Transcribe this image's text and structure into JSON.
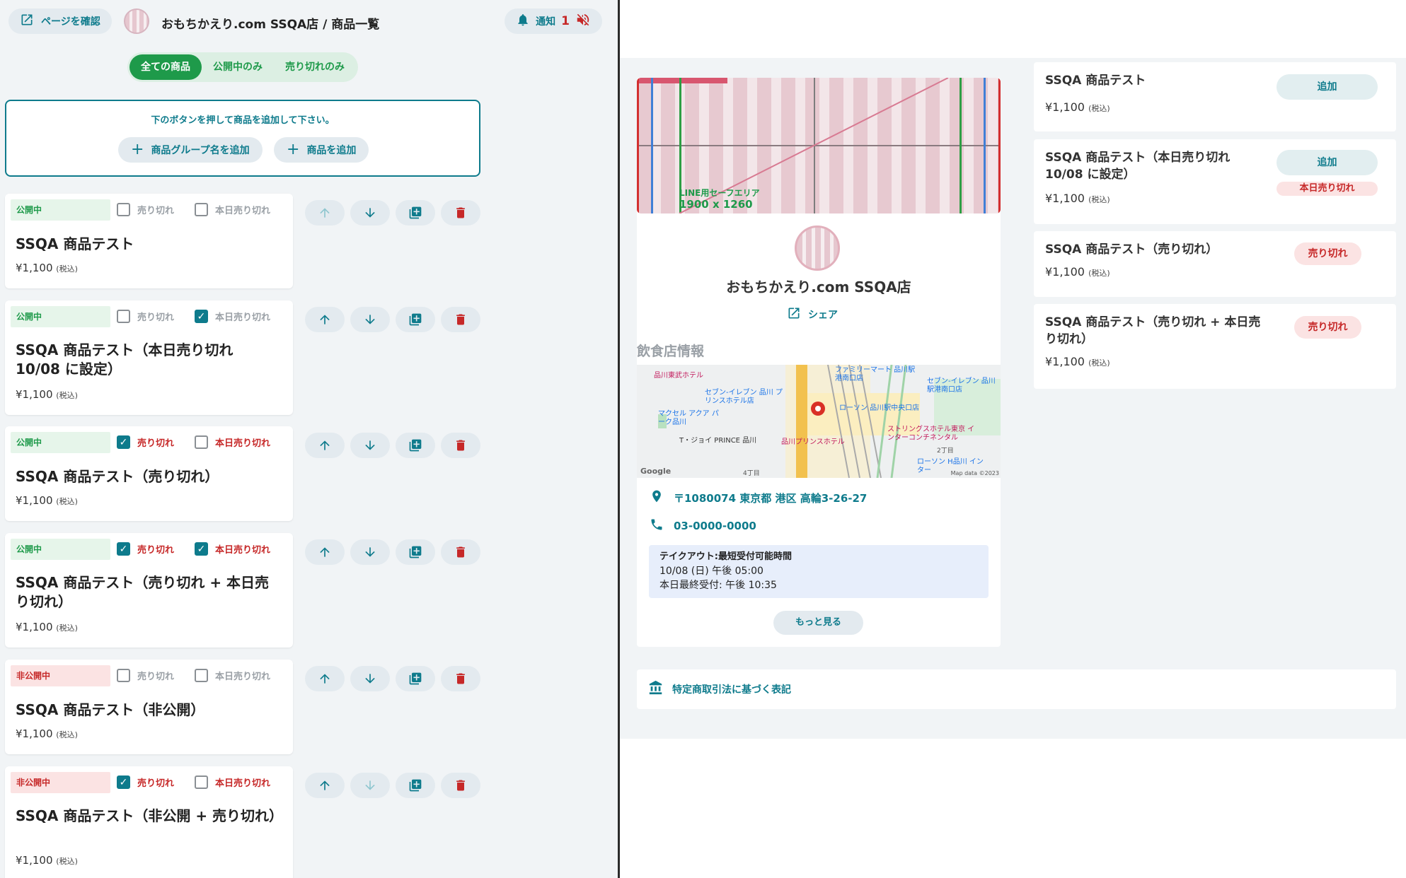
{
  "header": {
    "page_button_label": "ページを確認",
    "shop_title": "おもちかえり.com SSQA店 / 商品一覧",
    "notification_label": "通知",
    "notification_count": "1"
  },
  "filter_tabs": [
    {
      "label": "全ての商品",
      "active": true
    },
    {
      "label": "公開中のみ",
      "active": false
    },
    {
      "label": "売り切れのみ",
      "active": false
    }
  ],
  "add_box": {
    "message": "下のボタンを押して商品を追加して下さい。",
    "add_group_label": "商品グループ名を追加",
    "add_product_label": "商品を追加"
  },
  "products": [
    {
      "status": "公開中",
      "sold_out_label": "売り切れ",
      "today_label": "本日売り切れ",
      "name": "SSQA 商品テスト",
      "price": "¥1,100",
      "tax": "(税込)"
    },
    {
      "status": "公開中",
      "sold_out_label": "売り切れ",
      "today_label": "本日売り切れ",
      "name": "SSQA 商品テスト（本日売り切れ 10/08 に設定）",
      "price": "¥1,100",
      "tax": "(税込)"
    },
    {
      "status": "公開中",
      "sold_out_label": "売り切れ",
      "today_label": "本日売り切れ",
      "name": "SSQA 商品テスト（売り切れ）",
      "price": "¥1,100",
      "tax": "(税込)"
    },
    {
      "status": "公開中",
      "sold_out_label": "売り切れ",
      "today_label": "本日売り切れ",
      "name": "SSQA 商品テスト（売り切れ + 本日売り切れ）",
      "price": "¥1,100",
      "tax": "(税込)"
    },
    {
      "status": "非公開中",
      "sold_out_label": "売り切れ",
      "today_label": "本日売り切れ",
      "name": "SSQA 商品テスト（非公開）",
      "price": "¥1,100",
      "tax": "(税込)"
    },
    {
      "status": "非公開中",
      "sold_out_label": "売り切れ",
      "today_label": "本日売り切れ",
      "name": "SSQA 商品テスト（非公開 + 売り切れ）",
      "price": "¥1,100",
      "tax": "(税込)"
    }
  ],
  "preview": {
    "hero_safe_area": "LINE用セーフエリア",
    "hero_size": "1900 x 1260",
    "shop_name": "おもちかえり.com SSQA店",
    "share_label": "シェア",
    "info_heading": "飲食店情報",
    "address": "〒1080074 東京都 港区 高輪3-26-27",
    "phone": "03-0000-0000",
    "takeout_title": "テイクアウト:最短受付可能時間",
    "takeout_time": "10/08 (日) 午後 05:00",
    "takeout_last": "本日最終受付: 午後 10:35",
    "more_label": "もっと見る",
    "legal_label": "特定商取引法に基づく表記",
    "map_labels": {
      "hotel1": "品川東武ホテル",
      "seven1": "セブン-イレブン 品川 プリンスホテル店",
      "family": "ファミリーマート 品川駅港南口店",
      "seven2": "セブン-イレブン 品川駅港南口店",
      "lawson1": "ローソン 品川駅中央口店",
      "aqua": "マクセル アクア パーク品川",
      "tjoy": "T・ジョイ PRINCE 品川",
      "prince": "品川プリンスホテル",
      "string": "ストリングスホテル東京 インターコンチネンタル",
      "lawson2": "ローソン H品川 インター",
      "chome4": "4丁目",
      "chome2": "2丁目",
      "google": "Google",
      "mapdata": "Map data ©2023"
    }
  },
  "menu_items": [
    {
      "name": "SSQA 商品テスト",
      "price": "¥1,100",
      "tax": "(税込)",
      "add_label": "追加"
    },
    {
      "name": "SSQA 商品テスト（本日売り切れ 10/08 に設定）",
      "price": "¥1,100",
      "tax": "(税込)",
      "add_label": "追加",
      "today_tag": "本日売り切れ"
    },
    {
      "name": "SSQA 商品テスト（売り切れ）",
      "price": "¥1,100",
      "tax": "(税込)",
      "soldout_label": "売り切れ"
    },
    {
      "name": "SSQA 商品テスト（売り切れ + 本日売り切れ）",
      "price": "¥1,100",
      "tax": "(税込)",
      "soldout_label": "売り切れ"
    }
  ],
  "colors": {
    "accent": "#0e7b8c",
    "green": "#1e9a4a",
    "red": "#c62828",
    "bg": "#f1f4f6"
  }
}
